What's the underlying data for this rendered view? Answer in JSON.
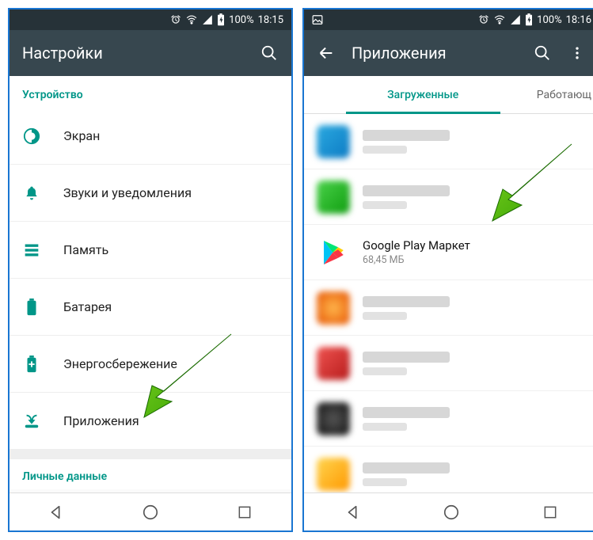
{
  "left": {
    "statusbar": {
      "battery": "100%",
      "time": "18:15"
    },
    "appbar": {
      "title": "Настройки"
    },
    "section1": "Устройство",
    "items": [
      {
        "label": "Экран",
        "icon": "display"
      },
      {
        "label": "Звуки и уведомления",
        "icon": "bell"
      },
      {
        "label": "Память",
        "icon": "storage"
      },
      {
        "label": "Батарея",
        "icon": "battery"
      },
      {
        "label": "Энергосбережение",
        "icon": "batterysaver"
      },
      {
        "label": "Приложения",
        "icon": "apps"
      }
    ],
    "section2": "Личные данные"
  },
  "right": {
    "statusbar": {
      "battery": "100%",
      "time": "18:16"
    },
    "appbar": {
      "title": "Приложения"
    },
    "tabs": {
      "active": "Загруженные",
      "other": "Работающ"
    },
    "highlighted_app": {
      "name": "Google Play Маркет",
      "size": "68,45 МБ"
    }
  }
}
